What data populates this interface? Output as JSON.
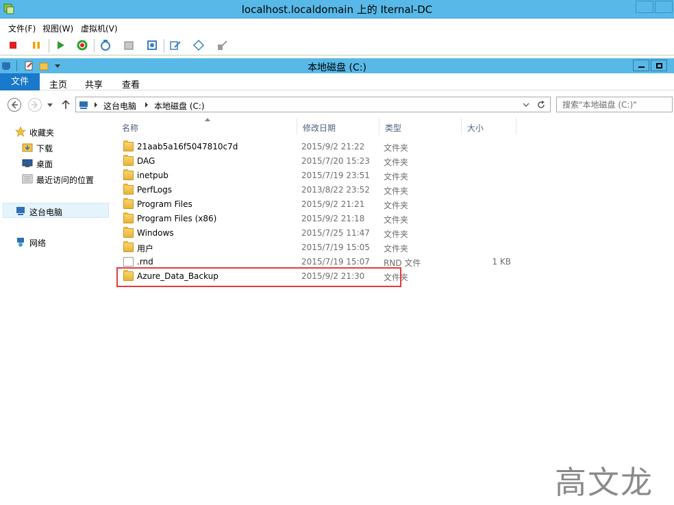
{
  "vm_window": {
    "title": "localhost.localdomain 上的 Iternal-DC",
    "menu": [
      "文件(F)",
      "视图(W)",
      "虚拟机(V)"
    ]
  },
  "explorer": {
    "title": "本地磁盘 (C:)",
    "ribbon_tabs": [
      "文件",
      "主页",
      "共享",
      "查看"
    ],
    "breadcrumb": [
      "这台电脑",
      "本地磁盘 (C:)"
    ],
    "search_placeholder": "搜索\"本地磁盘 (C:)\""
  },
  "nav_pane": {
    "favorites": "收藏夹",
    "downloads": "下载",
    "desktop": "桌面",
    "recent": "最近访问的位置",
    "this_pc": "这台电脑",
    "network": "网络"
  },
  "columns": [
    "名称",
    "修改日期",
    "类型",
    "大小"
  ],
  "files": [
    {
      "name": "21aab5a16f5047810c7d",
      "date": "2015/9/2 21:22",
      "type": "文件夹",
      "size": ""
    },
    {
      "name": "DAG",
      "date": "2015/7/20 15:23",
      "type": "文件夹",
      "size": ""
    },
    {
      "name": "inetpub",
      "date": "2015/7/19 23:51",
      "type": "文件夹",
      "size": ""
    },
    {
      "name": "PerfLogs",
      "date": "2013/8/22 23:52",
      "type": "文件夹",
      "size": ""
    },
    {
      "name": "Program Files",
      "date": "2015/9/2 21:21",
      "type": "文件夹",
      "size": ""
    },
    {
      "name": "Program Files (x86)",
      "date": "2015/9/2 21:18",
      "type": "文件夹",
      "size": ""
    },
    {
      "name": "Windows",
      "date": "2015/7/25 11:47",
      "type": "文件夹",
      "size": ""
    },
    {
      "name": "用户",
      "date": "2015/7/19 15:05",
      "type": "文件夹",
      "size": ""
    },
    {
      "name": ".rnd",
      "date": "2015/7/19 15:07",
      "type": "RND 文件",
      "size": "1 KB"
    },
    {
      "name": "Azure_Data_Backup",
      "date": "2015/9/2 21:30",
      "type": "文件夹",
      "size": ""
    }
  ],
  "watermark": "高文龙",
  "colors": {
    "title_bar": "#58b9e8",
    "file_tab": "#1979ca",
    "highlight": "#e53a3a"
  }
}
